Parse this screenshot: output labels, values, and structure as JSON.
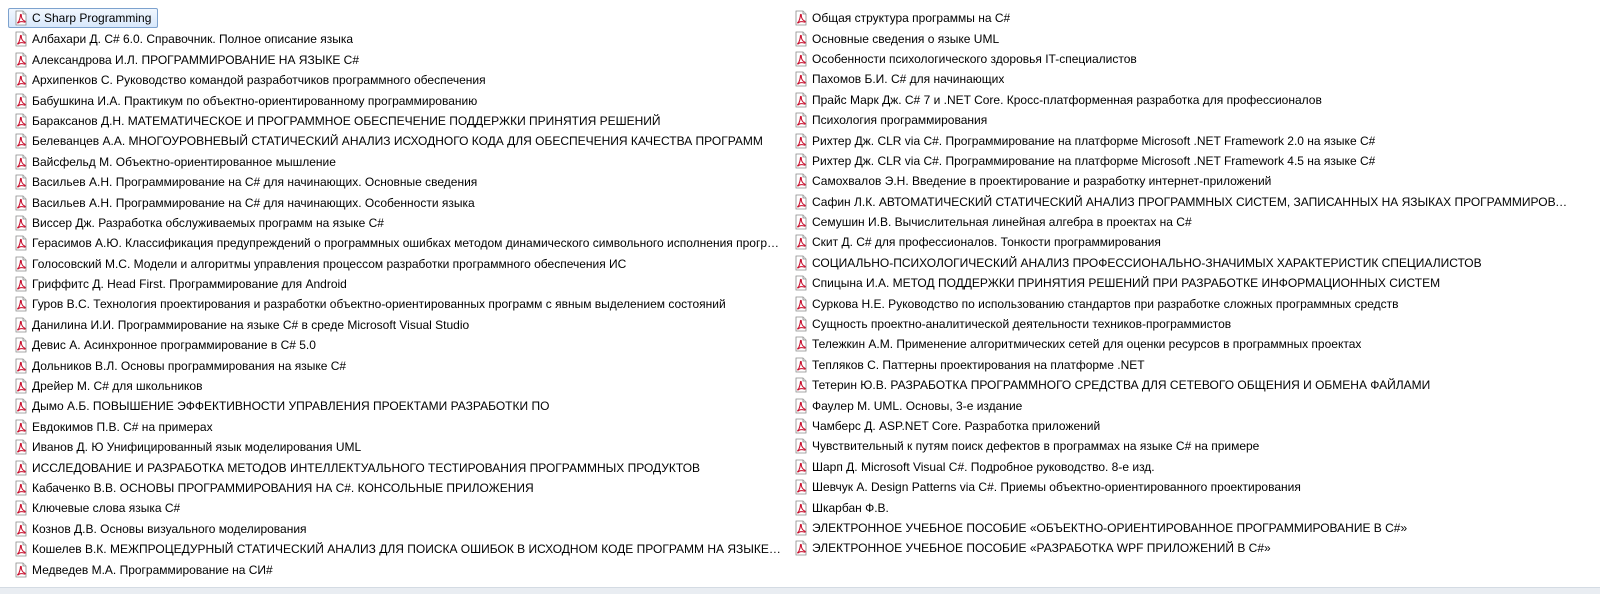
{
  "icon": "pdf-file-icon",
  "colors": {
    "pdf_red": "#c8102e",
    "selection_border": "#7da2ce"
  },
  "left_items": [
    "C Sharp Programming",
    "Албахари Д. C# 6.0. Справочник. Полное описание языка",
    "Александрова И.Л. ПРОГРАММИРОВАНИЕ НА ЯЗЫКЕ С#",
    "Архипенков С. Руководство командой разработчиков программного обеспечения",
    "Бабушкина И.А. Практикум по объектно-ориентированному программированию",
    "Бараксанов Д.Н. МАТЕМАТИЧЕСКОЕ И ПРОГРАММНОЕ ОБЕСПЕЧЕНИЕ ПОДДЕРЖКИ ПРИНЯТИЯ РЕШЕНИЙ",
    "Белеванцев А.А. МНОГОУРОВНЕВЫЙ СТАТИЧЕСКИЙ АНАЛИЗ ИСХОДНОГО КОДА ДЛЯ ОБЕСПЕЧЕНИЯ КАЧЕСТВА ПРОГРАММ",
    "Вайсфельд М. Объектно-ориентированное мышление",
    "Васильев А.Н. Программирование на C# для начинающих. Основные сведения",
    "Васильев А.Н. Программирование на C# для начинающих. Особенности языка",
    "Виссер Дж. Разработка обслуживаемых программ на языке С#",
    "Герасимов А.Ю. Классификация предупреждений о программных ошибках методом динамического символьного исполнения программ",
    "Голосовский М.С. Модели и алгоритмы управления процессом разработки программного обеспечения ИС",
    "Гриффитс Д. Head First. Программирование для Android",
    "Гуров В.С. Технология проектирования и разработки объектно-ориентированных программ с явным выделением состояний",
    "Данилина И.И. Программирование на языке С# в среде Microsoft Visual Studio",
    "Девис А. Асинхронное программирование в C# 5.0",
    "Дольников В.Л. Основы программирования на языке С#",
    "Дрейер М. C# для школьников",
    "Дымо А.Б. ПОВЫШЕНИЕ ЭФФЕКТИВНОСТИ УПРАВЛЕНИЯ ПРОЕКТАМИ РАЗРАБОТКИ ПО",
    "Евдокимов П.В. C# на примерах",
    "Иванов Д. Ю Унифицированный язык моделирования UML",
    "ИССЛЕДОВАНИЕ И РАЗРАБОТКА МЕТОДОВ ИНТЕЛЛЕКТУАЛЬНОГО ТЕСТИРОВАНИЯ ПРОГРАММНЫХ ПРОДУКТОВ",
    "Кабаченко В.В. ОСНОВЫ ПРОГРАММИРОВАНИЯ НА С#. КОНСОЛЬНЫЕ ПРИЛОЖЕНИЯ",
    "Ключевые слова языка С#",
    "Кознов Д.В. Основы визуального моделирования",
    "Кошелев В.К. МЕЖПРОЦЕДУРНЫЙ СТАТИЧЕСКИЙ АНАЛИЗ ДЛЯ ПОИСКА ОШИБОК В ИСХОДНОМ КОДЕ ПРОГРАММ НА ЯЗЫКЕ С#",
    "Медведев М.А. Программирование на СИ#"
  ],
  "right_items": [
    "Общая структура программы на С#",
    "Основные сведения о языке UML",
    "Особенности психологического здоровья IT-специалистов",
    "Пахомов Б.И. C# для начинающих",
    "Прайс Марк Дж. C# 7 и .NET Core. Кросс-платформенная разработка для профессионалов",
    "Психология программирования",
    "Рихтер Дж. CLR via C#. Программирование на платформе Microsoft .NET Framework 2.0 на языке C#",
    "Рихтер Дж. CLR via C#. Программирование на платформе Microsoft .NET Framework 4.5 на языке C#",
    "Самохвалов Э.Н. Введение в проектирование и разработку интернет-приложений",
    "Сафин Л.К. АВТОМАТИЧЕСКИЙ СТАТИЧЕСКИЙ АНАЛИЗ ПРОГРАММНЫХ СИСТЕМ, ЗАПИСАННЫХ НА ЯЗЫКАХ ПРОГРАММИРОВАНИЯ ...",
    "Семушин И.В. Вычислительная линейная алгебра в проектах на C#",
    "Скит Д. C# для профессионалов. Тонкости программирования",
    "СОЦИАЛЬНО-ПСИХОЛОГИЧЕСКИЙ АНАЛИЗ ПРОФЕССИОНАЛЬНО-ЗНАЧИМЫХ ХАРАКТЕРИСТИК СПЕЦИАЛИСТОВ",
    "Спицына И.А. МЕТОД ПОДДЕРЖКИ ПРИНЯТИЯ РЕШЕНИЙ ПРИ РАЗРАБОТКЕ ИНФОРМАЦИОННЫХ СИСТЕМ",
    "Суркова Н.Е. Руководство по использованию стандартов при разработке сложных программных средств",
    "Сущность проектно-аналитической деятельности техников-программистов",
    "Тележкин А.М. Применение алгоритмических сетей для оценки ресурсов в программных проектах",
    "Тепляков С. Паттерны проектирования на платформе .NET",
    "Тетерин Ю.В. РАЗРАБОТКА ПРОГРАММНОГО СРЕДСТВА ДЛЯ СЕТЕВОГО ОБЩЕНИЯ И ОБМЕНА ФАЙЛАМИ",
    "Фаулер М. UML. Основы, 3-е издание",
    "Чамберс Д. ASP.NET Core. Разработка приложений",
    "Чувствительный к путям поиск дефектов в программах на языке C# на примере",
    "Шарп Д. Microsoft Visual C#. Подробное руководство. 8-е изд.",
    "Шевчук А. Design Patterns via C#. Приемы объектно-ориентированного проектирования",
    "Шкарбан Ф.В.",
    "ЭЛЕКТРОННОЕ УЧЕБНОЕ ПОСОБИЕ «ОБЪЕКТНО-ОРИЕНТИРОВАННОЕ ПРОГРАММИРОВАНИЕ В C#»",
    "ЭЛЕКТРОННОЕ УЧЕБНОЕ ПОСОБИЕ «РАЗРАБОТКА WPF ПРИЛОЖЕНИЙ В C#»"
  ]
}
